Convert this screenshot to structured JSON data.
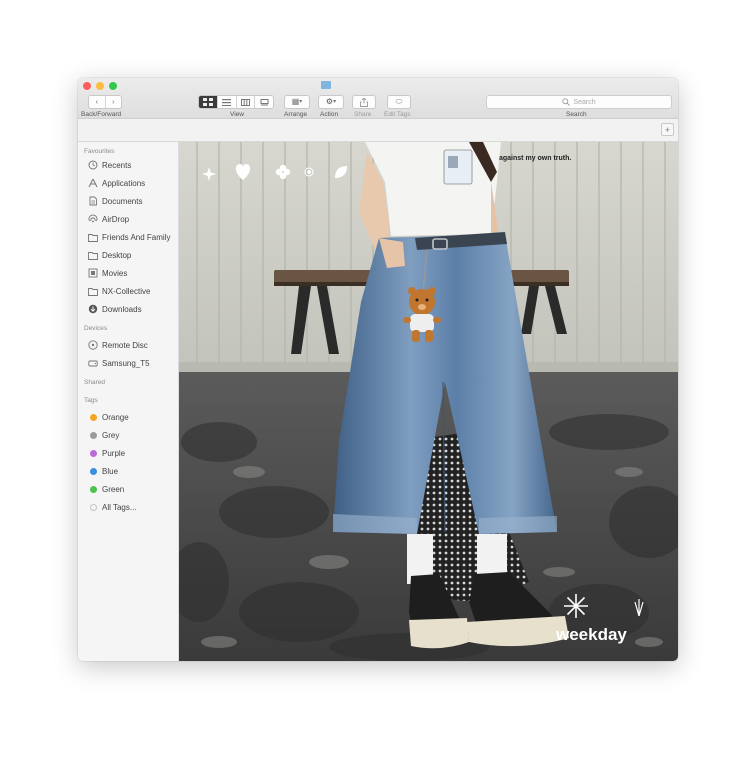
{
  "toolbar": {
    "back_forward_label": "Back/Forward",
    "back_glyph": "‹",
    "forward_glyph": "›",
    "view_label": "View",
    "arrange_label": "Arrange",
    "action_label": "Action",
    "share_label": "Share",
    "edit_tags_label": "Edit Tags",
    "search_label": "Search",
    "search_placeholder": "Search"
  },
  "sidebar": {
    "favourites_heading": "Favourites",
    "favourites": [
      {
        "label": "Recents",
        "icon": "clock-icon"
      },
      {
        "label": "Applications",
        "icon": "applications-icon"
      },
      {
        "label": "Documents",
        "icon": "document-icon"
      },
      {
        "label": "AirDrop",
        "icon": "airdrop-icon"
      },
      {
        "label": "Friends And Family",
        "icon": "folder-icon"
      },
      {
        "label": "Desktop",
        "icon": "desktop-icon"
      },
      {
        "label": "Movies",
        "icon": "film-icon"
      },
      {
        "label": "NX-Collective",
        "icon": "folder-icon"
      },
      {
        "label": "Downloads",
        "icon": "download-icon"
      }
    ],
    "devices_heading": "Devices",
    "devices": [
      {
        "label": "Remote Disc",
        "icon": "disc-icon"
      },
      {
        "label": "Samsung_T5",
        "icon": "drive-icon"
      }
    ],
    "shared_heading": "Shared",
    "tags_heading": "Tags",
    "tags": [
      {
        "label": "Orange",
        "color": "#f5a623"
      },
      {
        "label": "Grey",
        "color": "#9b9b9b"
      },
      {
        "label": "Purple",
        "color": "#b86bd8"
      },
      {
        "label": "Blue",
        "color": "#3a8de0"
      },
      {
        "label": "Green",
        "color": "#4cc34c"
      },
      {
        "label": "All Tags...",
        "color": "#d4d4d4"
      }
    ]
  },
  "photo": {
    "sign_text": "against my own truth.",
    "watermark": "weekday",
    "decor_icons": [
      "sparkle-icon",
      "heart-icon",
      "flower-icon",
      "target-icon",
      "leaf-icon"
    ]
  }
}
